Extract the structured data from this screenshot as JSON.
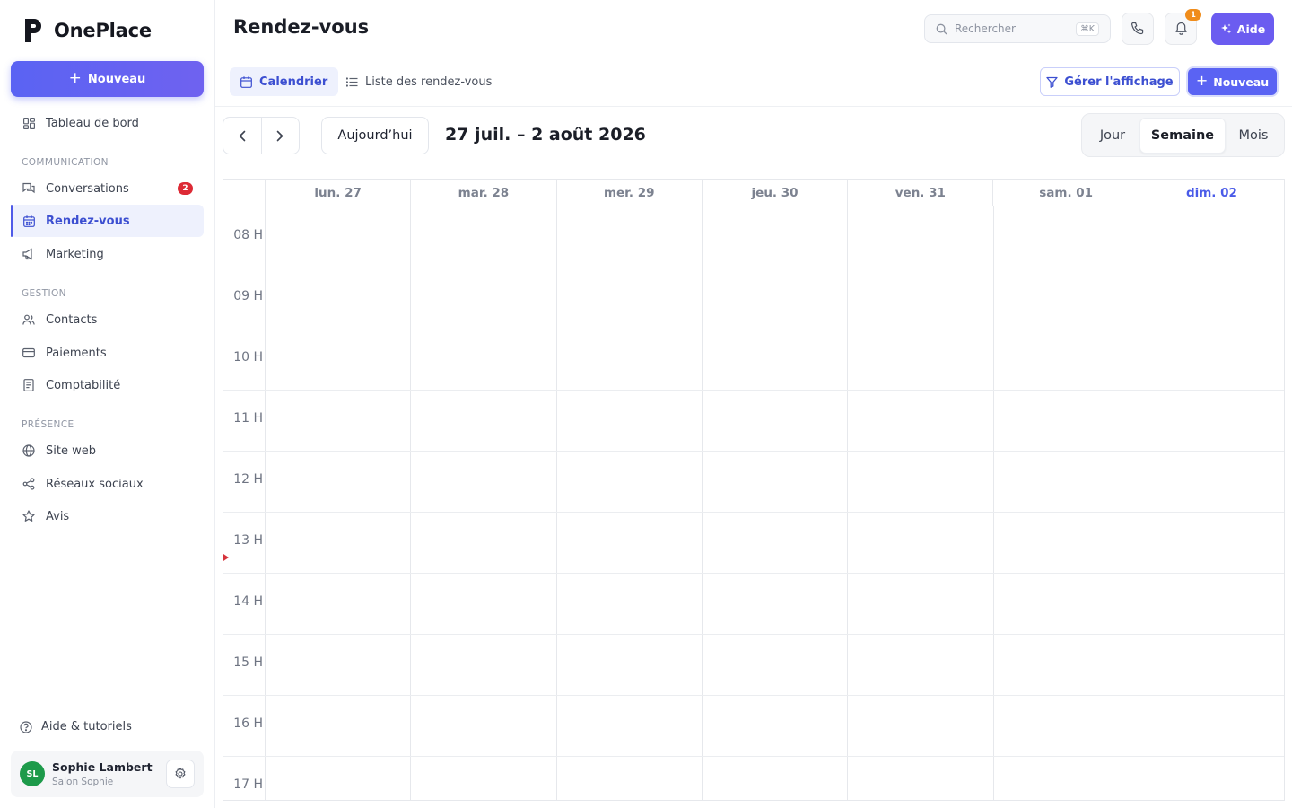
{
  "app": {
    "name": "OnePlace"
  },
  "sidebar": {
    "new_label": "Nouveau",
    "top_item": {
      "label": "Tableau de bord",
      "icon": "dashboard-icon"
    },
    "sections": [
      {
        "title": "COMMUNICATION",
        "items": [
          {
            "label": "Conversations",
            "icon": "chat-icon",
            "badge": "2"
          },
          {
            "label": "Rendez-vous",
            "icon": "calendar-icon",
            "active": true
          },
          {
            "label": "Marketing",
            "icon": "megaphone-icon"
          }
        ]
      },
      {
        "title": "GESTION",
        "items": [
          {
            "label": "Contacts",
            "icon": "users-icon"
          },
          {
            "label": "Paiements",
            "icon": "credit-card-icon"
          },
          {
            "label": "Comptabilité",
            "icon": "receipt-icon"
          }
        ]
      },
      {
        "title": "PRÉSENCE",
        "items": [
          {
            "label": "Site web",
            "icon": "globe-icon"
          },
          {
            "label": "Réseaux sociaux",
            "icon": "share-icon"
          },
          {
            "label": "Avis",
            "icon": "star-icon"
          }
        ]
      }
    ],
    "help_label": "Aide & tutoriels",
    "user": {
      "initials": "SL",
      "name": "Sophie Lambert",
      "org": "Salon Sophie"
    }
  },
  "header": {
    "title": "Rendez-vous",
    "search_placeholder": "Rechercher",
    "search_shortcut": "⌘K",
    "notification_count": "1",
    "help_label": "Aide"
  },
  "toolbar": {
    "tabs": [
      {
        "label": "Calendrier",
        "icon": "calendar-icon",
        "active": true
      },
      {
        "label": "Liste des rendez-vous",
        "icon": "list-icon"
      }
    ],
    "manage_label": "Gérer l'affichage",
    "new_label": "Nouveau"
  },
  "calendar": {
    "today_label": "Aujourd’hui",
    "range_label": "27 juil. – 2 août 2026",
    "views": [
      "Jour",
      "Semaine",
      "Mois"
    ],
    "active_view": "Semaine",
    "days": [
      "lun. 27",
      "mar. 28",
      "mer. 29",
      "jeu. 30",
      "ven. 31",
      "sam. 01",
      "dim. 02"
    ],
    "today_index": 6,
    "hours": [
      "08 H",
      "09 H",
      "10 H",
      "11 H",
      "12 H",
      "13 H",
      "14 H",
      "15 H",
      "16 H",
      "17 H"
    ],
    "current_time_hours": 13.75
  },
  "colors": {
    "accent": "#5a63f3",
    "today": "#4a5be8",
    "now_line": "#d6343c",
    "badge": "#dd2a35"
  }
}
